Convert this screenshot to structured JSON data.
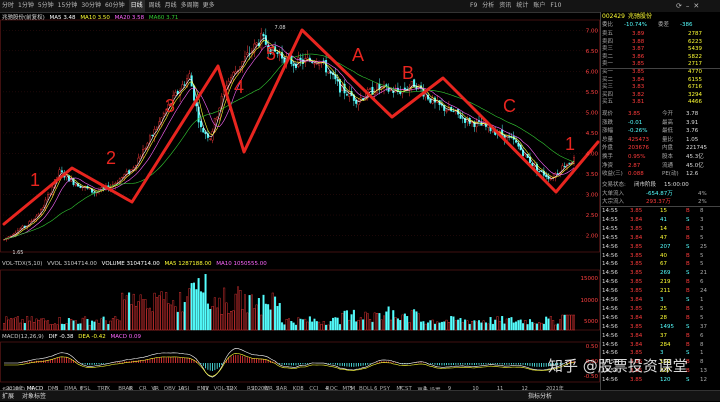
{
  "toolbar": {
    "period_tabs": [
      "分时",
      "1分钟",
      "5分钟",
      "15分钟",
      "30分钟",
      "60分钟",
      "日线",
      "周线",
      "月线",
      "多周期",
      "更多"
    ],
    "active_tab": "日线",
    "tool_labels": [
      "F9",
      "分析",
      "资讯",
      "统计",
      "账户",
      "F10"
    ]
  },
  "stock": {
    "name": "兆驰股份",
    "code": "002429",
    "price_label": "委比",
    "wei_bi": "-10.74%",
    "wei_cha_label": "委差",
    "wei_cha": "-386"
  },
  "main_legend": {
    "name": "兆驰股份(前复权)",
    "ma5_label": "MA5",
    "ma5": "3.48",
    "ma10_label": "MA10",
    "ma10": "3.50",
    "ma20_label": "MA20",
    "ma20": "3.58",
    "ma60_label": "MA60",
    "ma60": "3.71"
  },
  "price_marks": {
    "high": "7.08",
    "low": "1.65",
    "last": "3.85"
  },
  "y_axis": [
    "7.00",
    "6.50",
    "6.00",
    "5.50",
    "5.00",
    "4.50",
    "4.00",
    "3.50",
    "3.00",
    "2.50",
    "2.00"
  ],
  "vol_legend": {
    "name": "VOL-TDX(5,10)",
    "vvol_label": "VVOL",
    "vvol": "3104714.00",
    "vol_label": "VOLUME",
    "vol": "3104714.00",
    "ma5_label": "MA5",
    "ma5": "1287188.00",
    "ma10_label": "MA10",
    "ma10": "1050555.00"
  },
  "vol_axis": [
    "15000",
    "10000",
    "5000"
  ],
  "macd_legend": {
    "name": "MACD(12,26,9)",
    "dif_label": "DIF",
    "dif": "-0.38",
    "dea_label": "DEA",
    "dea": "-0.42",
    "macd_label": "MACD",
    "macd": "0.09"
  },
  "macd_axis": [
    "0.50",
    "0.00",
    "-0.50"
  ],
  "x_axis": [
    "2019年",
    "4",
    "5",
    "6",
    "7",
    "8",
    "9",
    "10",
    "11",
    "12",
    "2020年",
    "2",
    "3",
    "4",
    "5",
    "6",
    "7",
    "8",
    "9",
    "10",
    "11",
    "12",
    "2021年"
  ],
  "indicator_tabs": [
    "指标",
    "窗口",
    "MACD",
    "DMI",
    "DMA",
    "FSL",
    "TRIX",
    "BRAR",
    "CR",
    "VR",
    "OBV",
    "ASI",
    "EMV",
    "VOL-TDX",
    "RSI",
    "WR",
    "SAR",
    "KDJ",
    "CCI",
    "ROC",
    "MTM",
    "BOLL",
    "PSY",
    "MCST",
    "更多",
    "设置"
  ],
  "annotations": [
    "1",
    "2",
    "3",
    "4",
    "5",
    "A",
    "B",
    "C",
    "1"
  ],
  "order_book": {
    "sell": [
      {
        "label": "卖五",
        "price": "3.89",
        "vol": "2787"
      },
      {
        "label": "卖四",
        "price": "3.88",
        "vol": "6223"
      },
      {
        "label": "卖三",
        "price": "3.87",
        "vol": "5439"
      },
      {
        "label": "卖二",
        "price": "3.86",
        "vol": "5822"
      },
      {
        "label": "卖一",
        "price": "3.85",
        "vol": "2717"
      }
    ],
    "buy": [
      {
        "label": "买一",
        "price": "3.85",
        "vol": "4770"
      },
      {
        "label": "买二",
        "price": "3.84",
        "vol": "6155"
      },
      {
        "label": "买三",
        "price": "3.83",
        "vol": "6716"
      },
      {
        "label": "买四",
        "price": "3.82",
        "vol": "3294"
      },
      {
        "label": "买五",
        "price": "3.81",
        "vol": "4466"
      }
    ]
  },
  "stats": [
    {
      "l1": "现价",
      "v1": "3.85",
      "l2": "今开",
      "v2": "3.78"
    },
    {
      "l1": "涨跌",
      "v1": "-0.01",
      "l2": "最高",
      "v2": "3.91"
    },
    {
      "l1": "涨幅",
      "v1": "-0.26%",
      "l2": "最低",
      "v2": "3.76"
    },
    {
      "l1": "总量",
      "v1": "425473",
      "l2": "量比",
      "v2": "1.05"
    },
    {
      "l1": "外盘",
      "v1": "203676",
      "l2": "内盘",
      "v2": "221745"
    },
    {
      "l1": "换手",
      "v1": "0.95%",
      "l2": "股本",
      "v2": "45.3亿"
    },
    {
      "l1": "净资",
      "v1": "2.87",
      "l2": "流通",
      "v2": "45.0亿"
    },
    {
      "l1": "收益(三)",
      "v1": "0.088",
      "l2": "PE(动)",
      "v2": "12.6"
    }
  ],
  "trade_status": {
    "label": "交易状态:",
    "value": "闭市阶段",
    "time": "15:00:00"
  },
  "flows": [
    {
      "label": "大单流入",
      "value": "-654.87万",
      "extra": "4%"
    },
    {
      "label": "大宗流入",
      "value": "293.37万",
      "extra": "2%"
    }
  ],
  "ticks": [
    {
      "t": "14:55",
      "p": "3.85",
      "v": "15",
      "n": "8"
    },
    {
      "t": "14:55",
      "p": "3.84",
      "v": "41",
      "n": "3"
    },
    {
      "t": "14:55",
      "p": "3.85",
      "v": "14",
      "n": "3"
    },
    {
      "t": "14:55",
      "p": "3.84",
      "v": "47",
      "n": "5"
    },
    {
      "t": "14:56",
      "p": "3.85",
      "v": "207",
      "n": "25"
    },
    {
      "t": "14:56",
      "p": "3.85",
      "v": "40",
      "n": "5"
    },
    {
      "t": "14:56",
      "p": "3.85",
      "v": "67",
      "n": "5"
    },
    {
      "t": "14:56",
      "p": "3.85",
      "v": "269",
      "n": "21"
    },
    {
      "t": "14:56",
      "p": "3.85",
      "v": "219",
      "n": "6"
    },
    {
      "t": "14:56",
      "p": "3.85",
      "v": "211",
      "n": "24"
    },
    {
      "t": "14:56",
      "p": "3.84",
      "v": "3",
      "n": "1"
    },
    {
      "t": "14:56",
      "p": "3.85",
      "v": "25",
      "n": "5"
    },
    {
      "t": "14:56",
      "p": "3.84",
      "v": "28",
      "n": "5"
    },
    {
      "t": "14:56",
      "p": "3.85",
      "v": "1495",
      "n": "37"
    },
    {
      "t": "14:56",
      "p": "3.84",
      "v": "37",
      "n": "6"
    },
    {
      "t": "14:56",
      "p": "3.84",
      "v": "284",
      "n": "8"
    },
    {
      "t": "14:56",
      "p": "3.85",
      "v": "3",
      "n": "1"
    },
    {
      "t": "14:56",
      "p": "3.85",
      "v": "152",
      "n": "8"
    },
    {
      "t": "14:56",
      "p": "3.85",
      "v": "337",
      "n": "13"
    },
    {
      "t": "14:56",
      "p": "3.85",
      "v": "120",
      "n": "12"
    }
  ],
  "bottom_bar": {
    "tab1": "扩展",
    "tab2": "对象标签",
    "right_label": "指标分析"
  },
  "watermark": "知乎 @股票投资课堂",
  "colors": {
    "up": "#ff3b3b",
    "down": "#54ffff",
    "annot": "#e8251f",
    "ma5": "#ffffff",
    "ma10": "#ffff33",
    "ma20": "#ff66ff",
    "ma60": "#33cc33"
  }
}
